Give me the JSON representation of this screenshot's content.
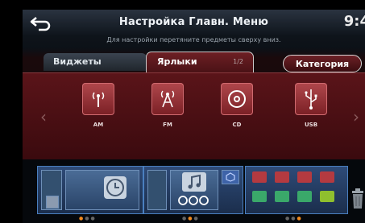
{
  "header": {
    "title": "Настройка Главн. Меню",
    "clock": "9:4",
    "hint": "Для настройки перетяните предметы сверху вниз."
  },
  "tabs": [
    {
      "label": "Виджеты"
    },
    {
      "label": "Ярлыки",
      "page": "1/2"
    }
  ],
  "category_button": {
    "label": "Категория"
  },
  "shortcuts": [
    {
      "label": "AM",
      "icon": "am-radio-icon"
    },
    {
      "label": "FM",
      "icon": "fm-radio-icon"
    },
    {
      "label": "CD",
      "icon": "cd-icon"
    },
    {
      "label": "USB",
      "icon": "usb-icon"
    }
  ],
  "home_pages": [
    {
      "page_index": 1,
      "active_dot": 1,
      "dot_count": 3
    },
    {
      "page_index": 2,
      "active_dot": 2,
      "dot_count": 3
    },
    {
      "page_index": 3,
      "active_dot": 3,
      "dot_count": 3
    }
  ],
  "colors": {
    "accent_red": "#7a2025",
    "page_blue": "#2e4b78",
    "dot_active": "#f28a1e"
  }
}
